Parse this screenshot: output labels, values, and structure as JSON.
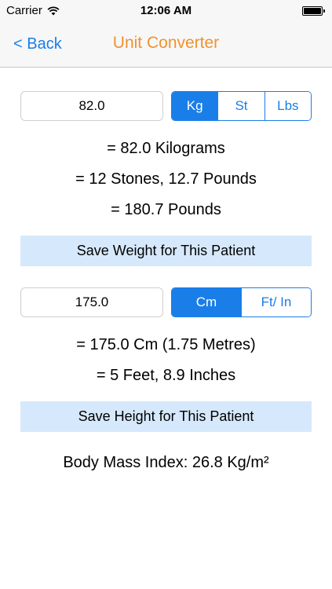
{
  "status_bar": {
    "carrier": "Carrier",
    "time": "12:06 AM",
    "battery_level": 1.0
  },
  "nav": {
    "back_label": "< Back",
    "title": "Unit Converter",
    "back_color": "#1a7ee8",
    "title_color": "#f0922e"
  },
  "weight": {
    "input_value": "82.0",
    "units": [
      "Kg",
      "St",
      "Lbs"
    ],
    "selected_unit": "Kg",
    "results": [
      "= 82.0 Kilograms",
      "= 12 Stones, 12.7 Pounds",
      "= 180.7 Pounds"
    ],
    "save_label": "Save Weight for This Patient"
  },
  "height": {
    "input_value": "175.0",
    "units": [
      "Cm",
      "Ft/ In"
    ],
    "selected_unit": "Cm",
    "results": [
      "= 175.0 Cm (1.75 Metres)",
      "= 5 Feet, 8.9 Inches"
    ],
    "save_label": "Save Height for This Patient"
  },
  "bmi": {
    "text": "Body Mass Index: 26.8 Kg/m²"
  },
  "colors": {
    "accent": "#1a7ee8",
    "save_button_bg": "#d6e8fb",
    "bar_bg": "#f7f7f8"
  }
}
